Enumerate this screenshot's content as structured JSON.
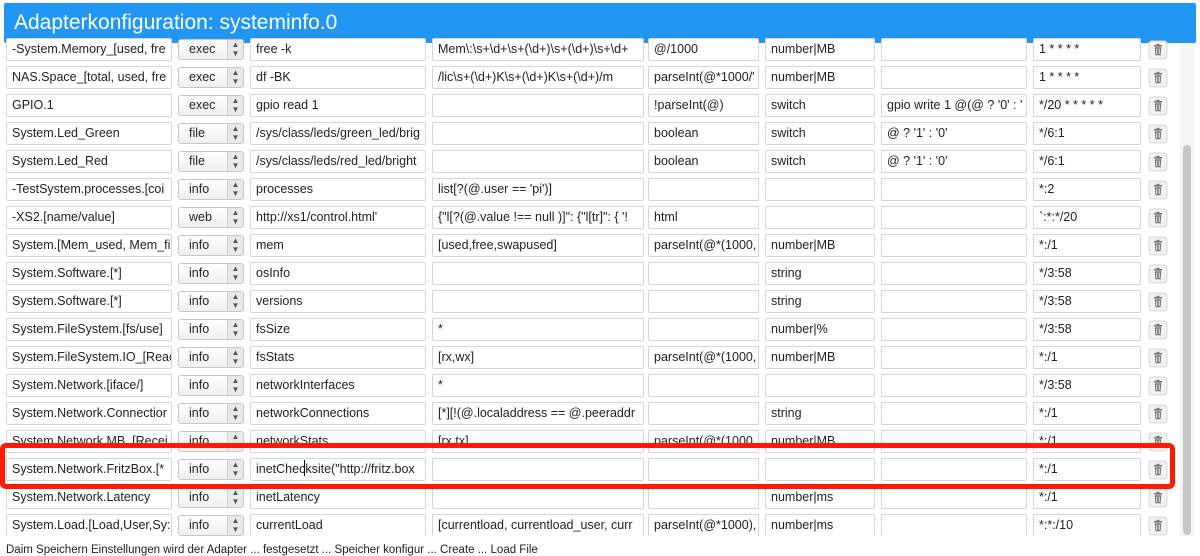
{
  "window": {
    "title": "Adapterkonfiguration: systeminfo.0"
  },
  "columns_x": [
    6,
    178,
    250,
    432,
    648,
    765,
    881,
    1033
  ],
  "rows": [
    {
      "name": "-System.Memory_[used, fre",
      "type": "exec",
      "source": "free -k",
      "regexp": "Mem\\:\\s+\\d+\\s+(\\d+)\\s+(\\d+)\\s+\\d+",
      "converter": "@/1000",
      "role": "number|MB",
      "write": "",
      "poll": "1 * * * *"
    },
    {
      "name": "NAS.Space_[total, used, fre",
      "type": "exec",
      "source": "df -BK",
      "regexp": "/lic\\s+(\\d+)K\\s+(\\d+)K\\s+(\\d+)/m",
      "converter": "parseInt(@*1000/'",
      "role": "number|MB",
      "write": "",
      "poll": "1 * * * *"
    },
    {
      "name": "GPIO.1",
      "type": "exec",
      "source": "gpio read 1",
      "regexp": "",
      "converter": "!parseInt(@)",
      "role": "switch",
      "write": "gpio write 1 @(@ ?  '0' : '",
      "poll": "*/20 * * * * *"
    },
    {
      "name": "System.Led_Green",
      "type": "file",
      "source": "/sys/class/leds/green_led/brig",
      "regexp": "",
      "converter": "boolean",
      "role": "switch",
      "write": "@ ? '1' : '0'",
      "poll": "*/6:1"
    },
    {
      "name": "System.Led_Red",
      "type": "file",
      "source": "/sys/class/leds/red_led/bright",
      "regexp": "",
      "converter": "boolean",
      "role": "switch",
      "write": "@ ? '1' : '0'",
      "poll": "*/6:1"
    },
    {
      "name": "-TestSystem.processes.[coi",
      "type": "info",
      "source": "processes",
      "regexp": "list[?(@.user == 'pi')]",
      "converter": "",
      "role": "",
      "write": "",
      "poll": "*:2"
    },
    {
      "name": "-XS2.[name/value]",
      "type": "web",
      "source": "http://xs1/control.html'",
      "regexp": "{\"l[?(@.value  !== null )]\": {\"l[tr]\": { '!",
      "converter": "html",
      "role": "",
      "write": "",
      "poll": "`:*:*/20"
    },
    {
      "name": "System.[Mem_used, Mem_fi",
      "type": "info",
      "source": "mem",
      "regexp": "[used,free,swapused]",
      "converter": "parseInt(@*(1000,",
      "role": "number|MB",
      "write": "",
      "poll": "*:/1"
    },
    {
      "name": "System.Software.[*]",
      "type": "info",
      "source": "osInfo",
      "regexp": "",
      "converter": "",
      "role": "string",
      "write": "",
      "poll": "*/3:58"
    },
    {
      "name": "System.Software.[*]",
      "type": "info",
      "source": "versions",
      "regexp": "",
      "converter": "",
      "role": "string",
      "write": "",
      "poll": "*/3:58"
    },
    {
      "name": "System.FileSystem.[fs/use]",
      "type": "info",
      "source": "fsSize",
      "regexp": "*",
      "converter": "",
      "role": "number|%",
      "write": "",
      "poll": "*/3:58"
    },
    {
      "name": "System.FileSystem.IO_[Reac",
      "type": "info",
      "source": "fsStats",
      "regexp": "[rx,wx]",
      "converter": "parseInt(@*(1000,",
      "role": "number|MB",
      "write": "",
      "poll": "*:/1"
    },
    {
      "name": "System.Network.[iface/]",
      "type": "info",
      "source": "networkInterfaces",
      "regexp": "*",
      "converter": "",
      "role": "",
      "write": "",
      "poll": "*/3:58"
    },
    {
      "name": "System.Network.Connectior",
      "type": "info",
      "source": "networkConnections",
      "regexp": "[*][!(@.localaddress == @.peeraddr",
      "converter": "",
      "role": "string",
      "write": "",
      "poll": "*:/1"
    },
    {
      "name": "System.Network.MB_[Recei",
      "type": "info",
      "source": "networkStats",
      "regexp": "[rx,tx]",
      "converter": "parseInt(@*(1000",
      "role": "number|MB",
      "write": "",
      "poll": "*:/1"
    },
    {
      "name": "System.Network.FritzBox.[*",
      "type": "info",
      "source": "inetChecksite(\"http://fritz.box",
      "regexp": "",
      "converter": "",
      "role": "",
      "write": "",
      "poll": "*:/1"
    },
    {
      "name": "System.Network.Latency",
      "type": "info",
      "source": "inetLatency",
      "regexp": "",
      "converter": "",
      "role": "number|ms",
      "write": "",
      "poll": "*:/1"
    },
    {
      "name": "System.Load.[Load,User,Sy:",
      "type": "info",
      "source": "currentLoad",
      "regexp": "[currentload, currentload_user, curr",
      "converter": "parseInt(@*1000),",
      "role": "number|ms",
      "write": "",
      "poll": "*:*:/10"
    }
  ],
  "footer": {
    "text": "Daim Speichern    Einstellungen wird der Adapter ... festgesetzt ... Speicher konfigur ... Create ... Load File"
  },
  "icons": {
    "delete": "trash-icon",
    "select": "chevron-updown-icon"
  },
  "colors": {
    "titlebar": "#2196f3",
    "highlight": "#ff1a00"
  }
}
